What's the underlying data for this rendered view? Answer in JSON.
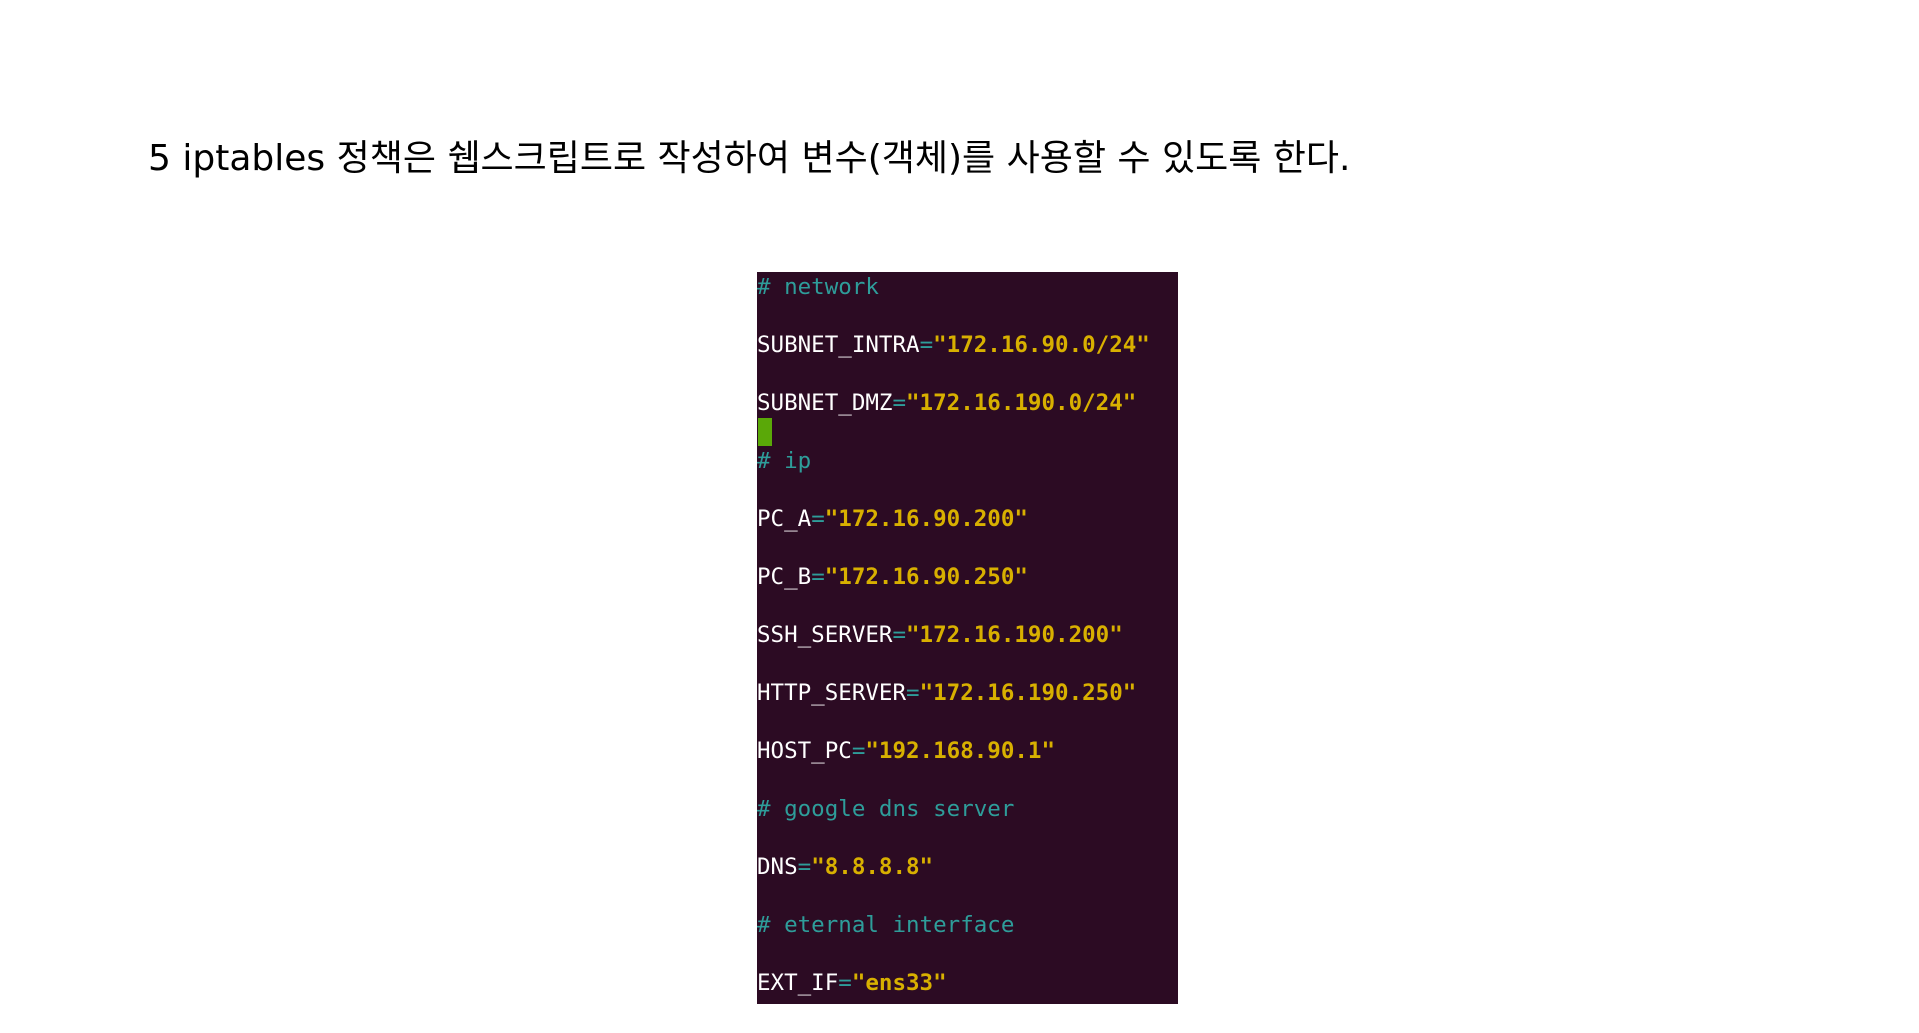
{
  "heading": "5 iptables 정책은 쉡스크립트로 작성하여 변수(객체)를 사용할 수 있도록 한다.",
  "terminal": {
    "lines": [
      {
        "type": "comment",
        "text": "# network"
      },
      {
        "type": "assign",
        "var": "SUBNET_INTRA",
        "eq": "=",
        "value": "\"172.16.90.0/24\""
      },
      {
        "type": "assign",
        "var": "SUBNET_DMZ",
        "eq": "=",
        "value": "\"172.16.190.0/24\""
      },
      {
        "type": "comment",
        "text": "# ip"
      },
      {
        "type": "assign",
        "var": "PC_A",
        "eq": "=",
        "value": "\"172.16.90.200\""
      },
      {
        "type": "assign",
        "var": "PC_B",
        "eq": "=",
        "value": "\"172.16.90.250\""
      },
      {
        "type": "assign",
        "var": "SSH_SERVER",
        "eq": "=",
        "value": "\"172.16.190.200\""
      },
      {
        "type": "assign",
        "var": "HTTP_SERVER",
        "eq": "=",
        "value": "\"172.16.190.250\""
      },
      {
        "type": "assign",
        "var": "HOST_PC",
        "eq": "=",
        "value": "\"192.168.90.1\""
      },
      {
        "type": "comment",
        "text": "# google dns server"
      },
      {
        "type": "assign",
        "var": "DNS",
        "eq": "=",
        "value": "\"8.8.8.8\""
      },
      {
        "type": "comment",
        "text": "# eternal interface"
      },
      {
        "type": "assign",
        "var": "EXT_IF",
        "eq": "=",
        "value": "\"ens33\""
      }
    ]
  },
  "colors": {
    "terminal_bg": "#2c0b23",
    "comment": "#2e9d9a",
    "string": "#d8b000",
    "cursor": "#5aa808"
  }
}
